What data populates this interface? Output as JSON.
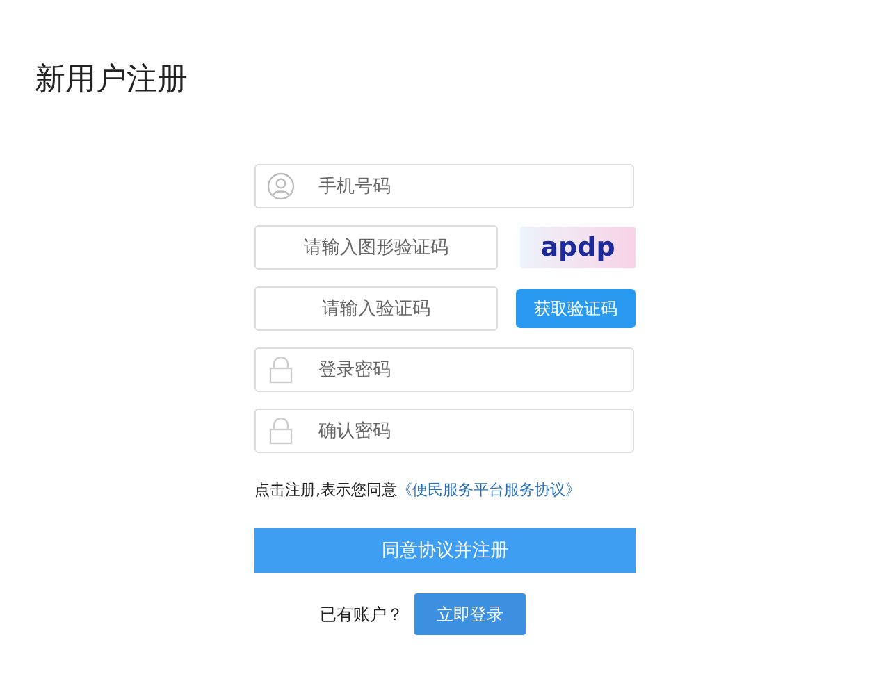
{
  "page": {
    "title": "新用户注册"
  },
  "form": {
    "phone": {
      "placeholder": "手机号码"
    },
    "captcha": {
      "placeholder": "请输入图形验证码",
      "image_text": "apdp"
    },
    "sms": {
      "placeholder": "请输入验证码",
      "button": "获取验证码"
    },
    "password": {
      "placeholder": "登录密码"
    },
    "confirm": {
      "placeholder": "确认密码"
    },
    "agreement": {
      "text": "点击注册,表示您同意",
      "link": "《便民服务平台服务协议》"
    },
    "submit": "同意协议并注册",
    "login_prompt": "已有账户？",
    "login_button": "立即登录"
  }
}
